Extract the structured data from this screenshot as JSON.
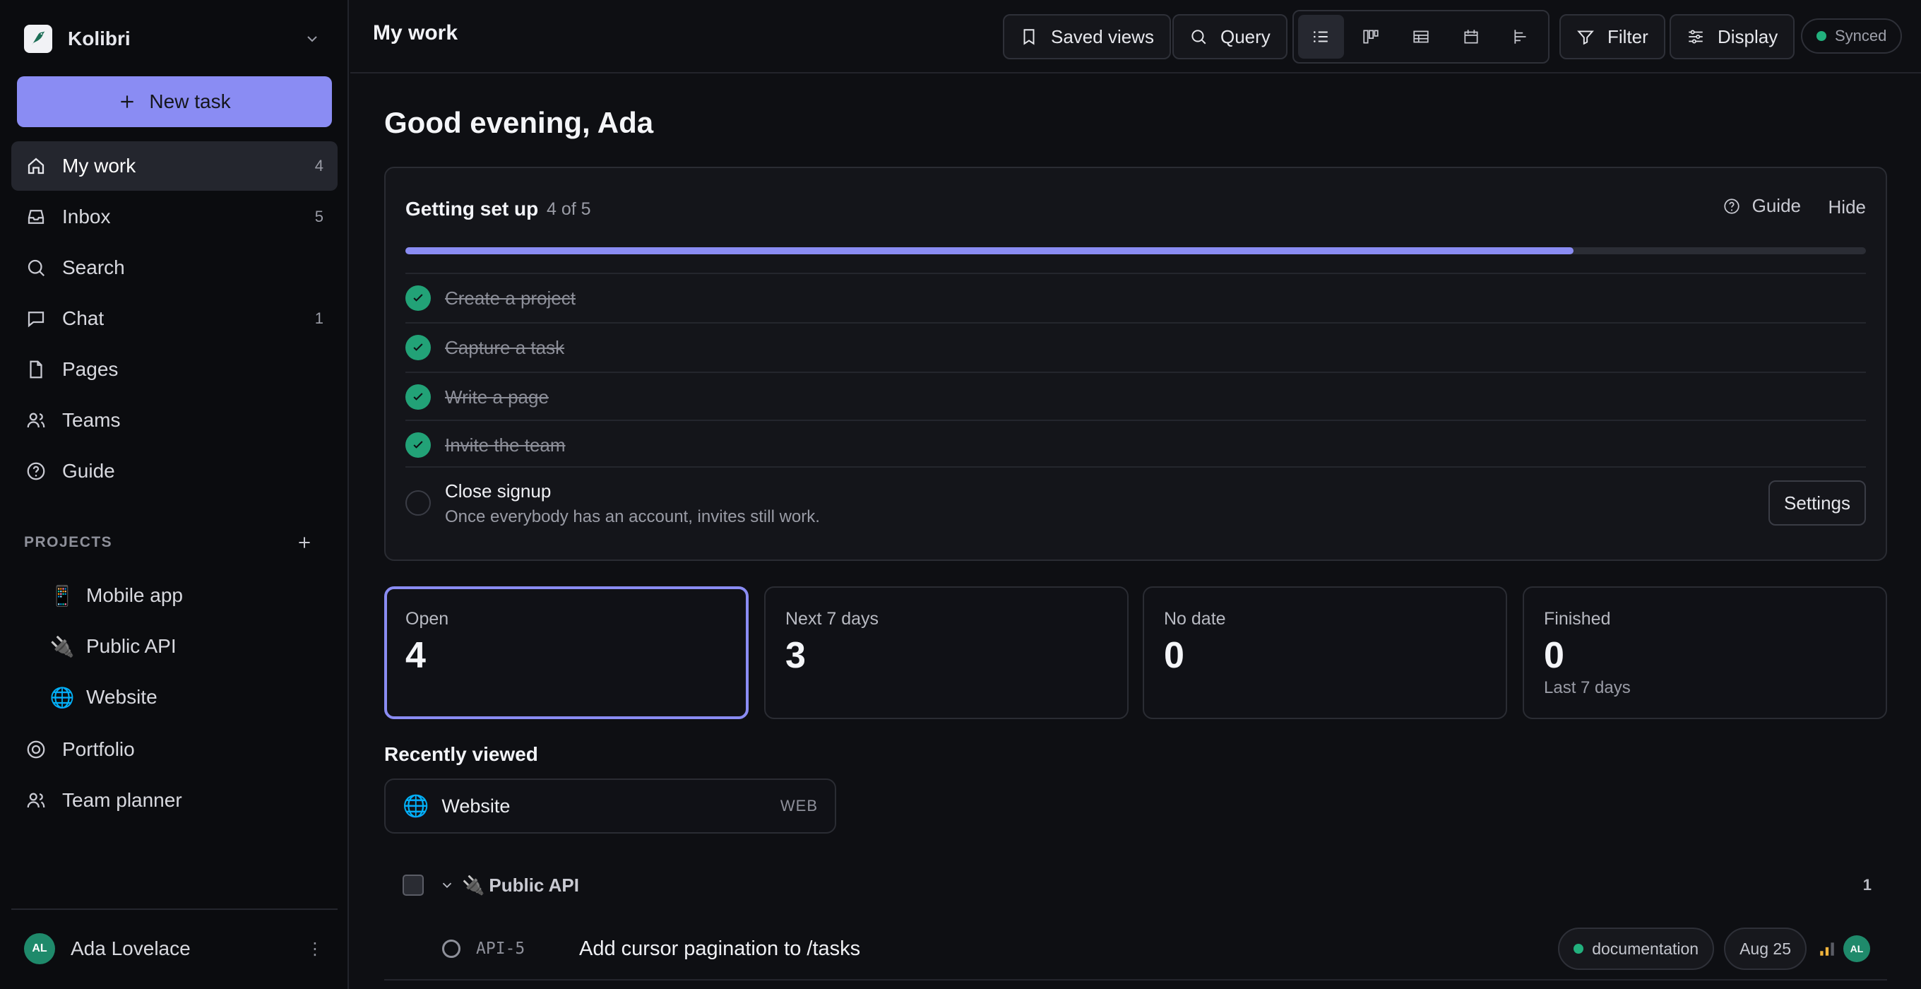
{
  "workspace": {
    "name": "Kolibri"
  },
  "sidebar": {
    "new_task_label": "New task",
    "nav": [
      {
        "label": "My work",
        "count": "4",
        "icon": "home-icon"
      },
      {
        "label": "Inbox",
        "count": "5",
        "icon": "inbox-icon"
      },
      {
        "label": "Search",
        "count": "",
        "icon": "search-icon"
      },
      {
        "label": "Chat",
        "count": "1",
        "icon": "chat-icon"
      },
      {
        "label": "Pages",
        "count": "",
        "icon": "page-icon"
      },
      {
        "label": "Teams",
        "count": "",
        "icon": "users-icon"
      },
      {
        "label": "Guide",
        "count": "",
        "icon": "help-circle-icon"
      }
    ],
    "projects_heading": "PROJECTS",
    "projects": [
      {
        "emoji": "📱",
        "label": "Mobile app"
      },
      {
        "emoji": "🔌",
        "label": "Public API"
      },
      {
        "emoji": "🌐",
        "label": "Website"
      }
    ],
    "nav2": [
      {
        "label": "Portfolio",
        "icon": "target-icon"
      },
      {
        "label": "Team planner",
        "icon": "users-icon"
      }
    ],
    "user": {
      "initials": "AL",
      "name": "Ada Lovelace"
    }
  },
  "topbar": {
    "title": "My work",
    "saved_views": "Saved views",
    "query": "Query",
    "filter": "Filter",
    "display": "Display",
    "synced": "Synced"
  },
  "main": {
    "greeting": "Good evening, Ada",
    "setup": {
      "title": "Getting set up",
      "count": "4 of 5",
      "progress": 0.8,
      "guide": "Guide",
      "hide": "Hide",
      "done_steps": [
        "Create a project",
        "Capture a task",
        "Write a page",
        "Invite the team"
      ],
      "last_step": {
        "title": "Close signup",
        "desc": "Once everybody has an account, invites still work.",
        "button": "Settings"
      }
    },
    "stats": [
      {
        "label": "Open",
        "value": "4",
        "sub": ""
      },
      {
        "label": "Next 7 days",
        "value": "3",
        "sub": ""
      },
      {
        "label": "No date",
        "value": "0",
        "sub": ""
      },
      {
        "label": "Finished",
        "value": "0",
        "sub": "Last 7 days"
      }
    ],
    "recent": {
      "title": "Recently viewed",
      "item": {
        "emoji": "🌐",
        "name": "Website",
        "key": "WEB"
      }
    },
    "group": {
      "emoji": "🔌",
      "name": "Public API",
      "count": "1",
      "task": {
        "id": "API-5",
        "title": "Add cursor pagination to /tasks",
        "label": "documentation",
        "date": "Aug 25",
        "assignee": "AL"
      }
    }
  },
  "colors": {
    "accent": "#8a8cf3",
    "success": "#22a277",
    "background": "#0e0f13"
  }
}
